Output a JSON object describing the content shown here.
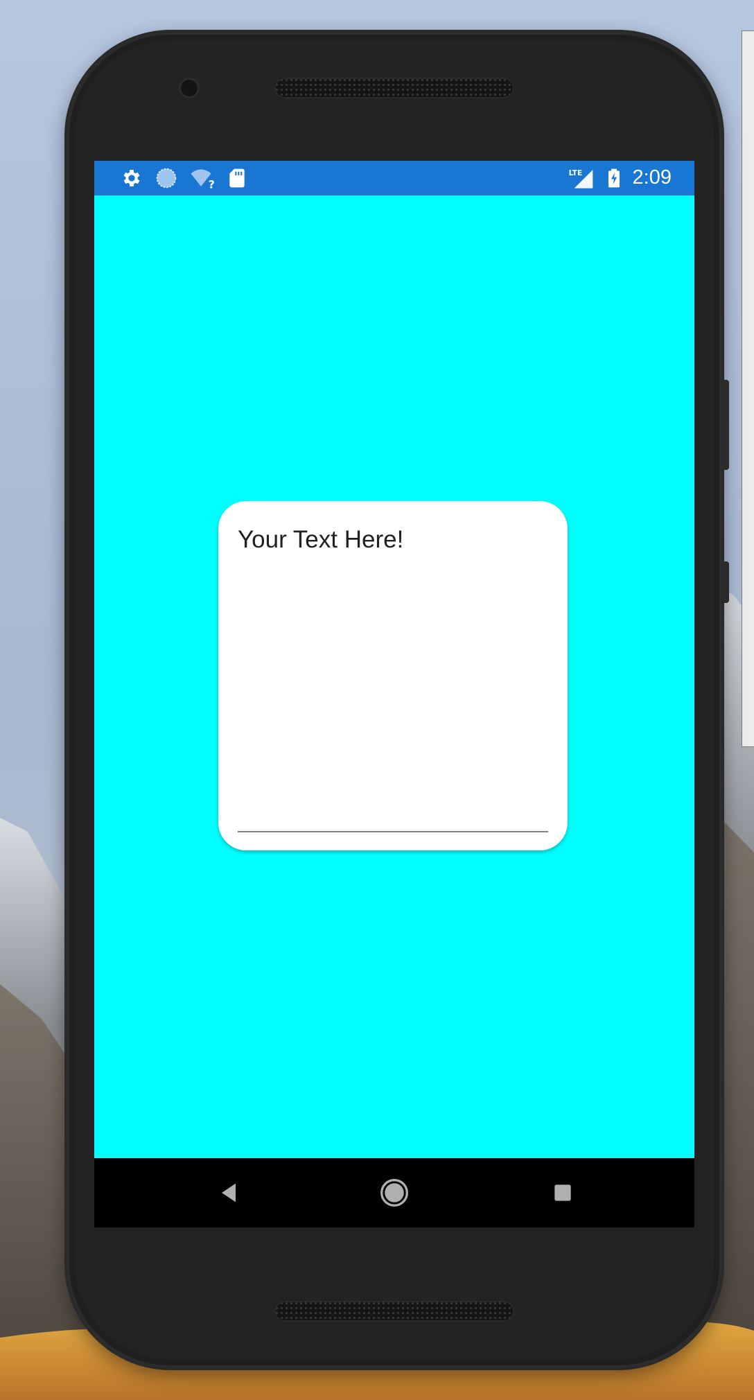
{
  "status_bar": {
    "time": "2:09",
    "network": "LTE",
    "left_icons": [
      "gear-icon",
      "sync-icon",
      "wifi-unknown-icon",
      "sd-card-icon"
    ],
    "right_icons": [
      "lte-signal-icon",
      "battery-charging-icon"
    ],
    "color": "#1976d2"
  },
  "screen": {
    "background_color": "#00ffff"
  },
  "card": {
    "text": "Your Text Here!",
    "background_color": "#ffffff"
  },
  "nav_bar": {
    "buttons": [
      "back-icon",
      "home-icon",
      "recents-icon"
    ]
  }
}
